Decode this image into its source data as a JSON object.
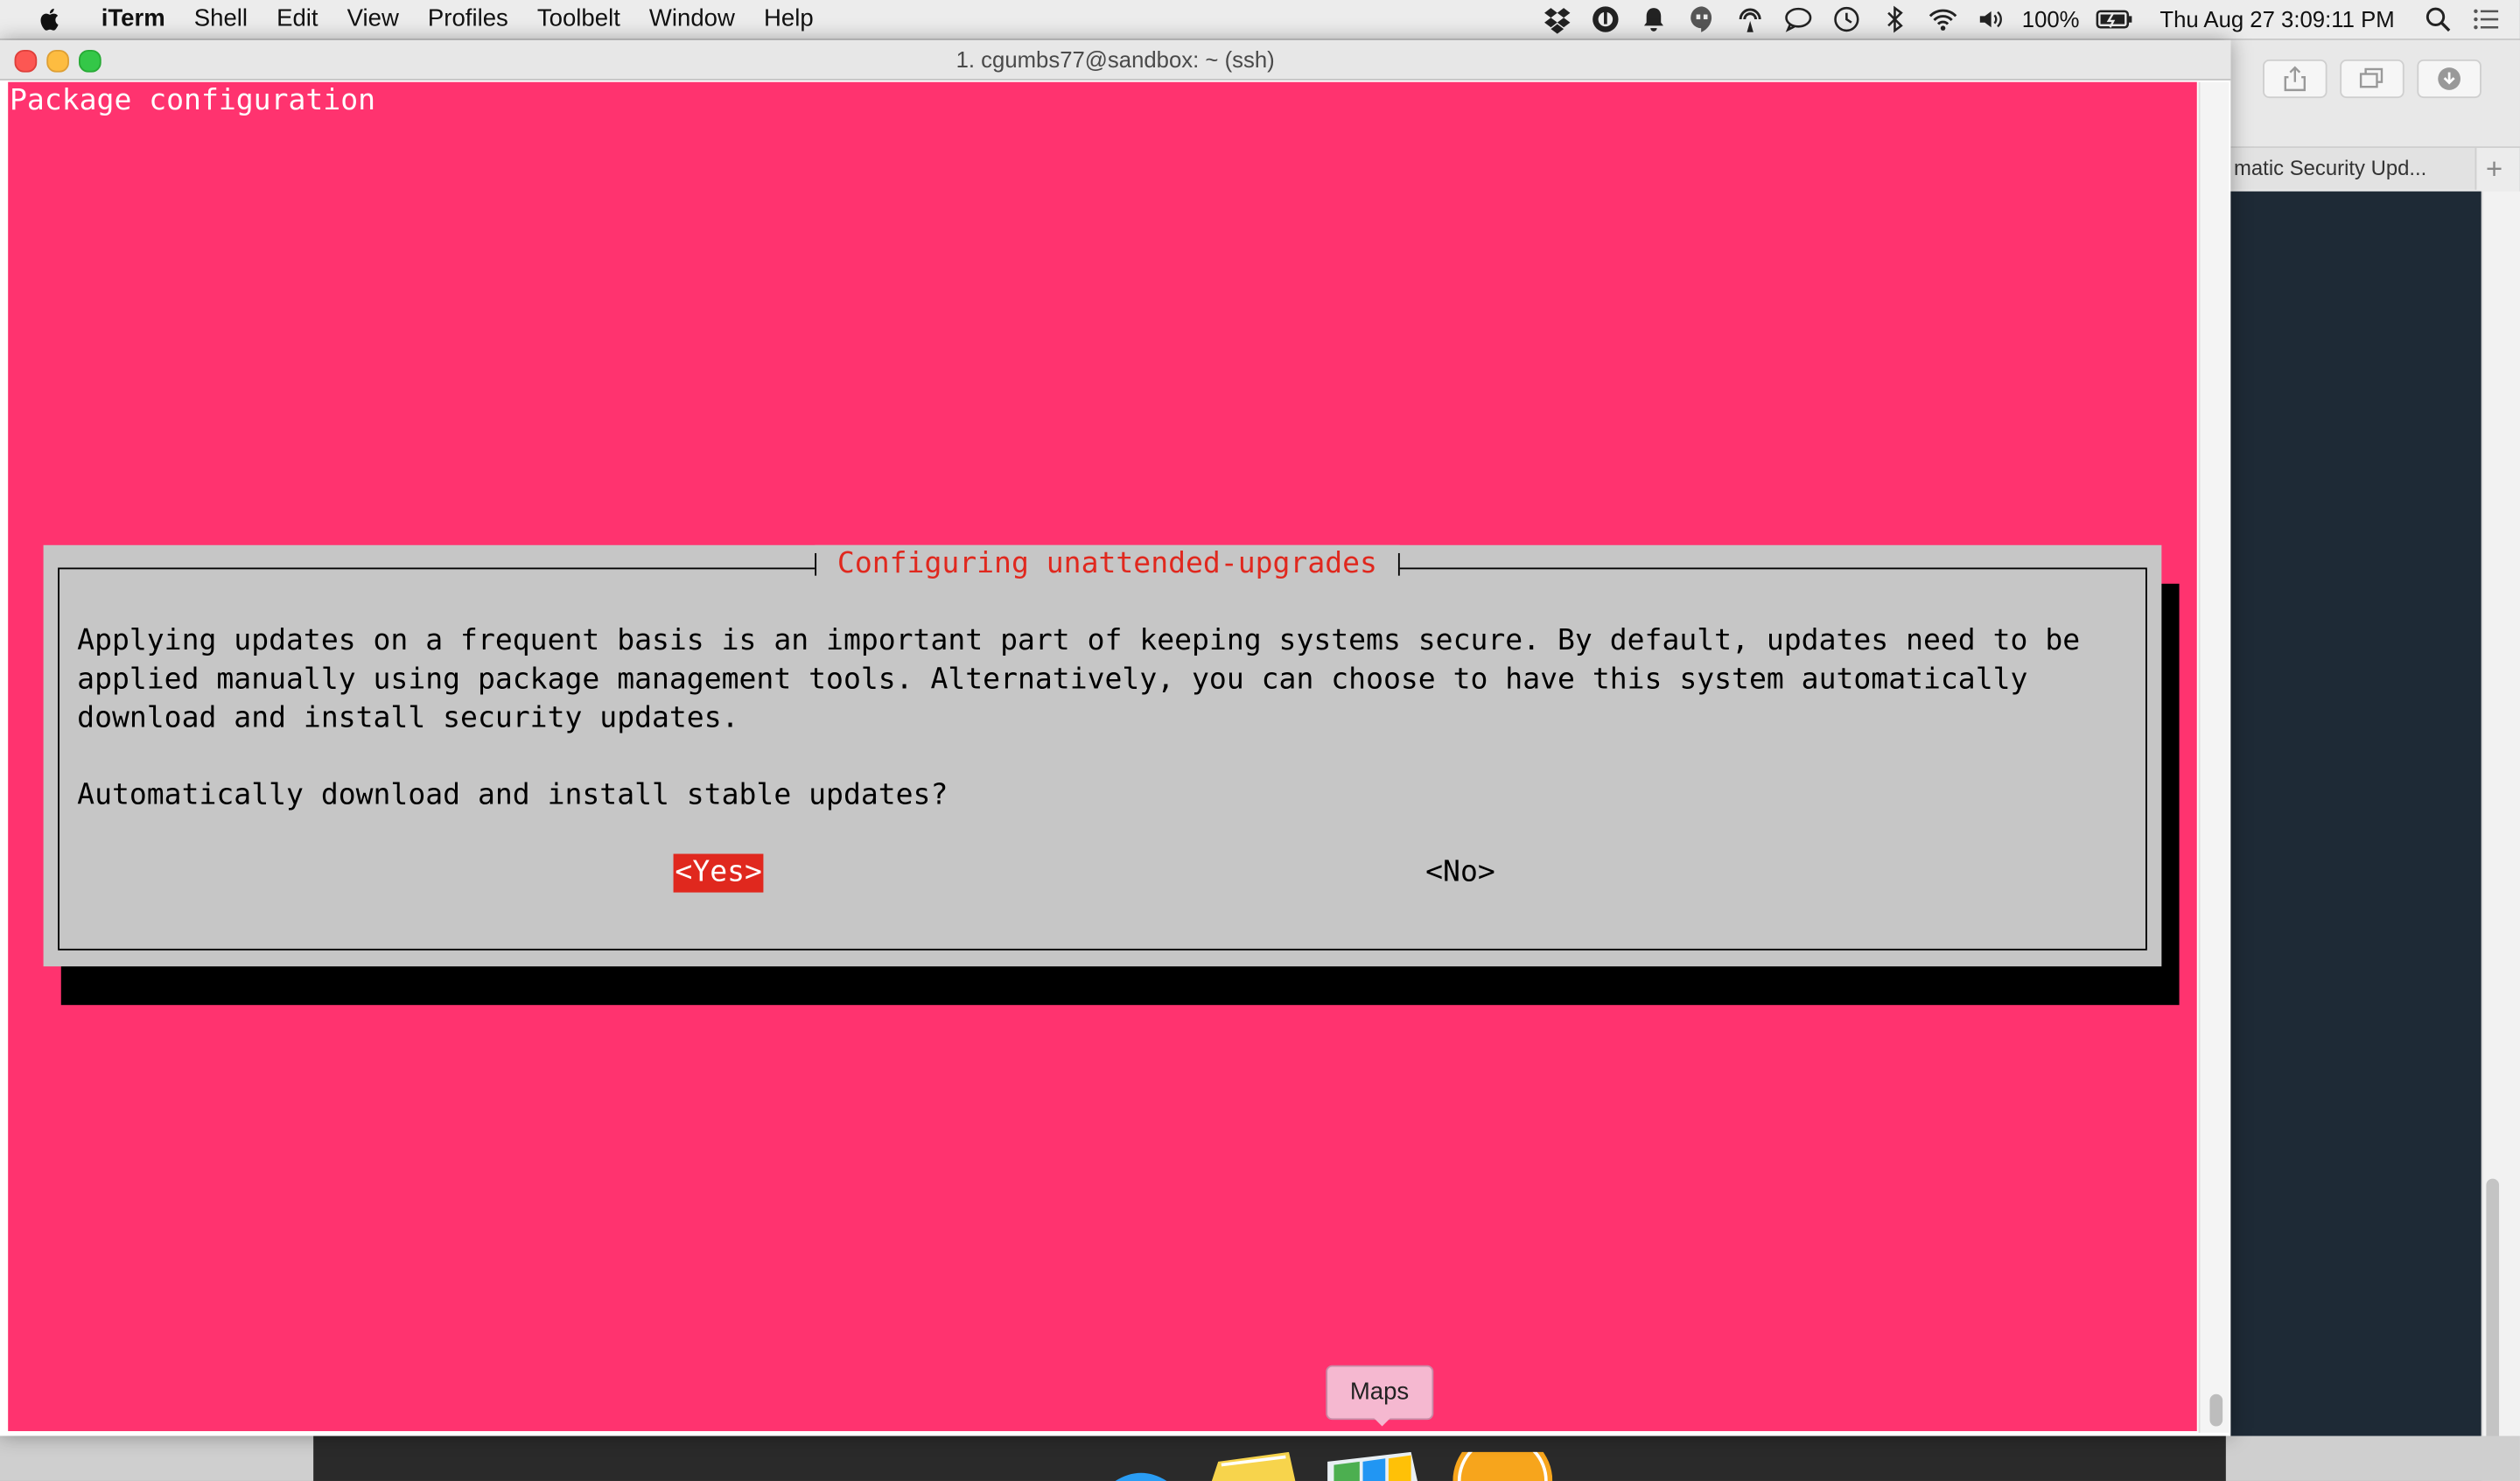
{
  "menubar": {
    "app_name": "iTerm",
    "items": [
      "Shell",
      "Edit",
      "View",
      "Profiles",
      "Toolbelt",
      "Window",
      "Help"
    ],
    "battery_text": "100%",
    "clock": "Thu Aug 27  3:09:11 PM",
    "status_icons": [
      "dropbox-icon",
      "alfred-icon",
      "bell-icon",
      "hangouts-icon",
      "airdrop-icon",
      "messages-icon",
      "time-machine-icon",
      "bluetooth-icon",
      "wifi-icon",
      "volume-icon",
      "battery-icon",
      "spotlight-icon",
      "notification-center-icon"
    ]
  },
  "terminal_window": {
    "title": "1. cgumbs77@sandbox: ~ (ssh)",
    "header_line": "Package configuration",
    "background_color": "#ff336f"
  },
  "dialog": {
    "title": "Configuring unattended-upgrades",
    "lines": [
      "Applying updates on a frequent basis is an important part of keeping systems secure. By default, updates need to be",
      "applied manually using package management tools. Alternatively, you can choose to have this system automatically",
      "download and install security updates."
    ],
    "question": "Automatically download and install stable updates?",
    "yes_label": "<Yes>",
    "no_label": "<No>",
    "selected_color": "#e0281e"
  },
  "browser_window": {
    "tab_title": "matic Security Upd...",
    "new_tab_label": "+"
  },
  "dock": {
    "tooltip": "Maps"
  }
}
